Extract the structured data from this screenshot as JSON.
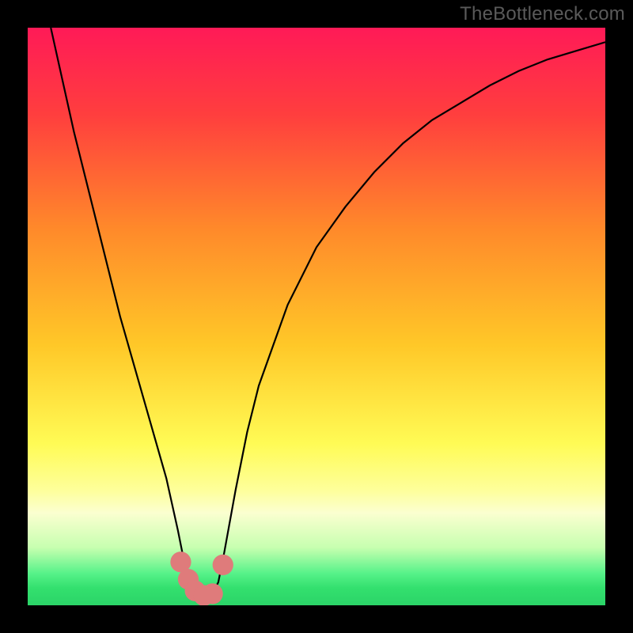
{
  "watermark": "TheBottleneck.com",
  "chart_data": {
    "type": "line",
    "title": "",
    "xlabel": "",
    "ylabel": "",
    "xlim": [
      0,
      1
    ],
    "ylim": [
      0,
      1
    ],
    "gradient_stops": [
      {
        "offset": 0.0,
        "color": "#ff1a57"
      },
      {
        "offset": 0.15,
        "color": "#ff3e3e"
      },
      {
        "offset": 0.35,
        "color": "#ff8a2a"
      },
      {
        "offset": 0.55,
        "color": "#ffc828"
      },
      {
        "offset": 0.72,
        "color": "#fffb55"
      },
      {
        "offset": 0.8,
        "color": "#feff9a"
      },
      {
        "offset": 0.84,
        "color": "#fbffd0"
      },
      {
        "offset": 0.9,
        "color": "#c7ffb0"
      },
      {
        "offset": 0.945,
        "color": "#56f289"
      },
      {
        "offset": 0.97,
        "color": "#33e06e"
      },
      {
        "offset": 1.0,
        "color": "#2bd468"
      }
    ],
    "series": [
      {
        "name": "bottleneck-curve",
        "x": [
          0.04,
          0.06,
          0.08,
          0.1,
          0.12,
          0.14,
          0.16,
          0.18,
          0.2,
          0.22,
          0.24,
          0.26,
          0.27,
          0.28,
          0.29,
          0.3,
          0.31,
          0.32,
          0.33,
          0.34,
          0.36,
          0.38,
          0.4,
          0.45,
          0.5,
          0.55,
          0.6,
          0.65,
          0.7,
          0.75,
          0.8,
          0.85,
          0.9,
          0.95,
          1.0
        ],
        "y": [
          1.0,
          0.91,
          0.82,
          0.74,
          0.66,
          0.58,
          0.5,
          0.43,
          0.36,
          0.29,
          0.22,
          0.13,
          0.08,
          0.04,
          0.02,
          0.015,
          0.015,
          0.02,
          0.04,
          0.09,
          0.2,
          0.3,
          0.38,
          0.52,
          0.62,
          0.69,
          0.75,
          0.8,
          0.84,
          0.87,
          0.9,
          0.925,
          0.945,
          0.96,
          0.975
        ]
      }
    ],
    "markers": [
      {
        "x": 0.265,
        "y": 0.075,
        "r": 0.018
      },
      {
        "x": 0.278,
        "y": 0.045,
        "r": 0.018
      },
      {
        "x": 0.29,
        "y": 0.025,
        "r": 0.018
      },
      {
        "x": 0.305,
        "y": 0.017,
        "r": 0.018
      },
      {
        "x": 0.32,
        "y": 0.02,
        "r": 0.018
      },
      {
        "x": 0.338,
        "y": 0.07,
        "r": 0.018
      }
    ],
    "marker_color": "#df7b7b"
  }
}
